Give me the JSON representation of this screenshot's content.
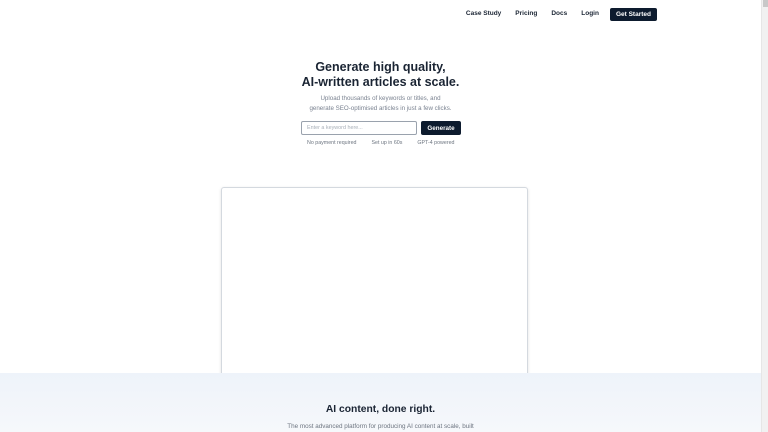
{
  "nav": {
    "items": [
      {
        "label": "Case Study"
      },
      {
        "label": "Pricing"
      },
      {
        "label": "Docs"
      },
      {
        "label": "Login"
      }
    ],
    "cta_label": "Get Started"
  },
  "hero": {
    "title_line1": "Generate high quality,",
    "title_line2": "AI-written articles at scale.",
    "subtitle_line1": "Upload thousands of keywords or titles, and",
    "subtitle_line2": "generate SEO-optimised articles in just a few clicks.",
    "input_placeholder": "Enter a keyword here...",
    "input_value": "",
    "generate_label": "Generate",
    "features": [
      "No payment required",
      "Set up in 60s",
      "GPT-4 powered"
    ]
  },
  "section2": {
    "title": "AI content, done right.",
    "subtitle": "The most advanced platform for producing AI content at scale, built"
  },
  "colors": {
    "primary": "#0d1b2e",
    "text": "#1a2433",
    "muted": "#7a8290",
    "section_bg": "#eef3fa"
  }
}
